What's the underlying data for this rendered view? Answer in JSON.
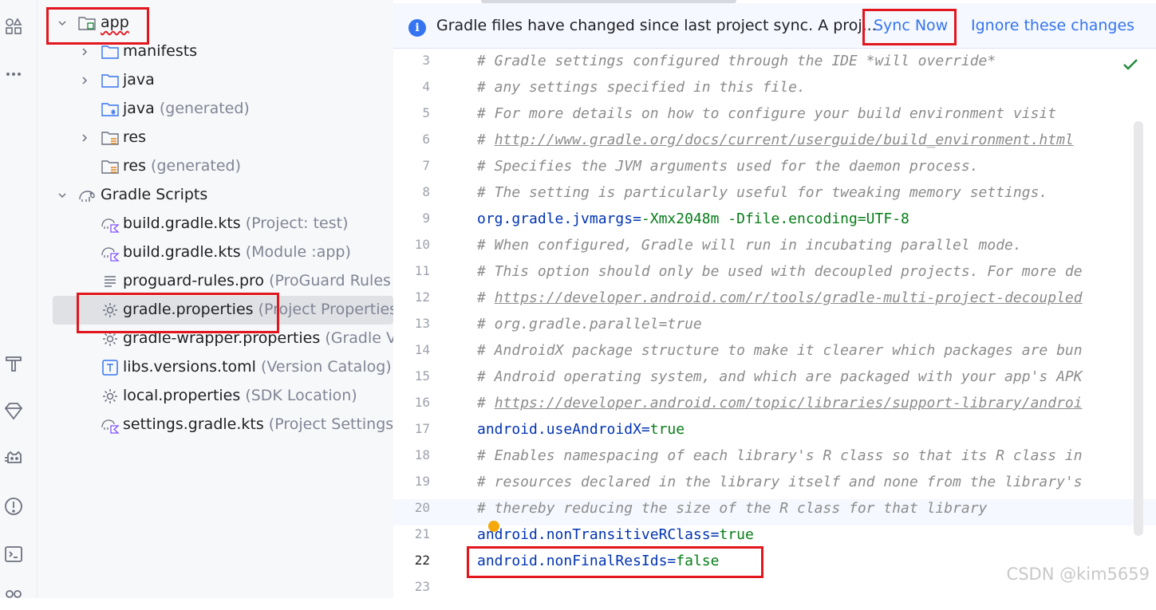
{
  "project_tree": {
    "rows": [
      {
        "label": "app",
        "hint": ""
      },
      {
        "label": "manifests",
        "hint": ""
      },
      {
        "label": "java",
        "hint": ""
      },
      {
        "label": "java",
        "hint": "(generated)"
      },
      {
        "label": "res",
        "hint": ""
      },
      {
        "label": "res",
        "hint": "(generated)"
      },
      {
        "label": "Gradle Scripts",
        "hint": ""
      },
      {
        "label": "build.gradle.kts",
        "hint": "(Project: test)"
      },
      {
        "label": "build.gradle.kts",
        "hint": "(Module :app)"
      },
      {
        "label": "proguard-rules.pro",
        "hint": "(ProGuard Rules f"
      },
      {
        "label": "gradle.properties",
        "hint": "(Project Properties)"
      },
      {
        "label": "gradle-wrapper.properties",
        "hint": "(Gradle Ve"
      },
      {
        "label": "libs.versions.toml",
        "hint": "(Version Catalog)"
      },
      {
        "label": "local.properties",
        "hint": "(SDK Location)"
      },
      {
        "label": "settings.gradle.kts",
        "hint": "(Project Settings)"
      }
    ]
  },
  "banner": {
    "message": "Gradle files have changed since last project sync. A proj...",
    "sync_now": "Sync Now",
    "ignore": "Ignore these changes"
  },
  "editor": {
    "line_numbers": [
      "3",
      "4",
      "5",
      "6",
      "7",
      "8",
      "9",
      "10",
      "11",
      "12",
      "13",
      "14",
      "15",
      "16",
      "17",
      "18",
      "19",
      "20",
      "21",
      "22",
      "23"
    ],
    "lines": [
      {
        "kind": "comment",
        "text": "# Gradle settings configured through the IDE *will override*"
      },
      {
        "kind": "comment",
        "text": "# any settings specified in this file."
      },
      {
        "kind": "comment",
        "text": "# For more details on how to configure your build environment visit"
      },
      {
        "kind": "comment_link",
        "prefix": "# ",
        "text": "http://www.gradle.org/docs/current/userguide/build_environment.html"
      },
      {
        "kind": "comment",
        "text": "# Specifies the JVM arguments used for the daemon process."
      },
      {
        "kind": "comment",
        "text": "# The setting is particularly useful for tweaking memory settings."
      },
      {
        "kind": "prop",
        "key": "org.gradle.jvmargs",
        "eq": "=",
        "value": "-Xmx2048m -Dfile.encoding=UTF-8"
      },
      {
        "kind": "comment",
        "text": "# When configured, Gradle will run in incubating parallel mode."
      },
      {
        "kind": "comment",
        "text": "# This option should only be used with decoupled projects. For more de"
      },
      {
        "kind": "comment_link",
        "prefix": "# ",
        "text": "https://developer.android.com/r/tools/gradle-multi-project-decoupled"
      },
      {
        "kind": "comment",
        "text": "# org.gradle.parallel=true"
      },
      {
        "kind": "comment",
        "text": "# AndroidX package structure to make it clearer which packages are bun"
      },
      {
        "kind": "comment",
        "text": "# Android operating system, and which are packaged with your app's APK"
      },
      {
        "kind": "comment_link",
        "prefix": "# ",
        "text": "https://developer.android.com/topic/libraries/support-library/androi"
      },
      {
        "kind": "prop",
        "key": "android.useAndroidX",
        "eq": "=",
        "value": "true"
      },
      {
        "kind": "comment",
        "text": "# Enables namespacing of each library's R class so that its R class in"
      },
      {
        "kind": "comment",
        "text": "# resources declared in the library itself and none from the library's"
      },
      {
        "kind": "comment",
        "text": "# thereby reducing the size of the R class for that library"
      },
      {
        "kind": "prop",
        "key": "android.nonTransitiveRClass",
        "eq": "=",
        "value": "true"
      },
      {
        "kind": "prop",
        "key": "android.nonFinalResIds",
        "eq": "=",
        "value": "false"
      },
      {
        "kind": "empty",
        "text": ""
      }
    ]
  },
  "watermark": "CSDN @kim5659",
  "colors": {
    "highlight_red": "#e2171e",
    "link_blue": "#3574f0",
    "comment": "#8c8c8c",
    "key": "#0033b3",
    "value": "#067d17"
  }
}
